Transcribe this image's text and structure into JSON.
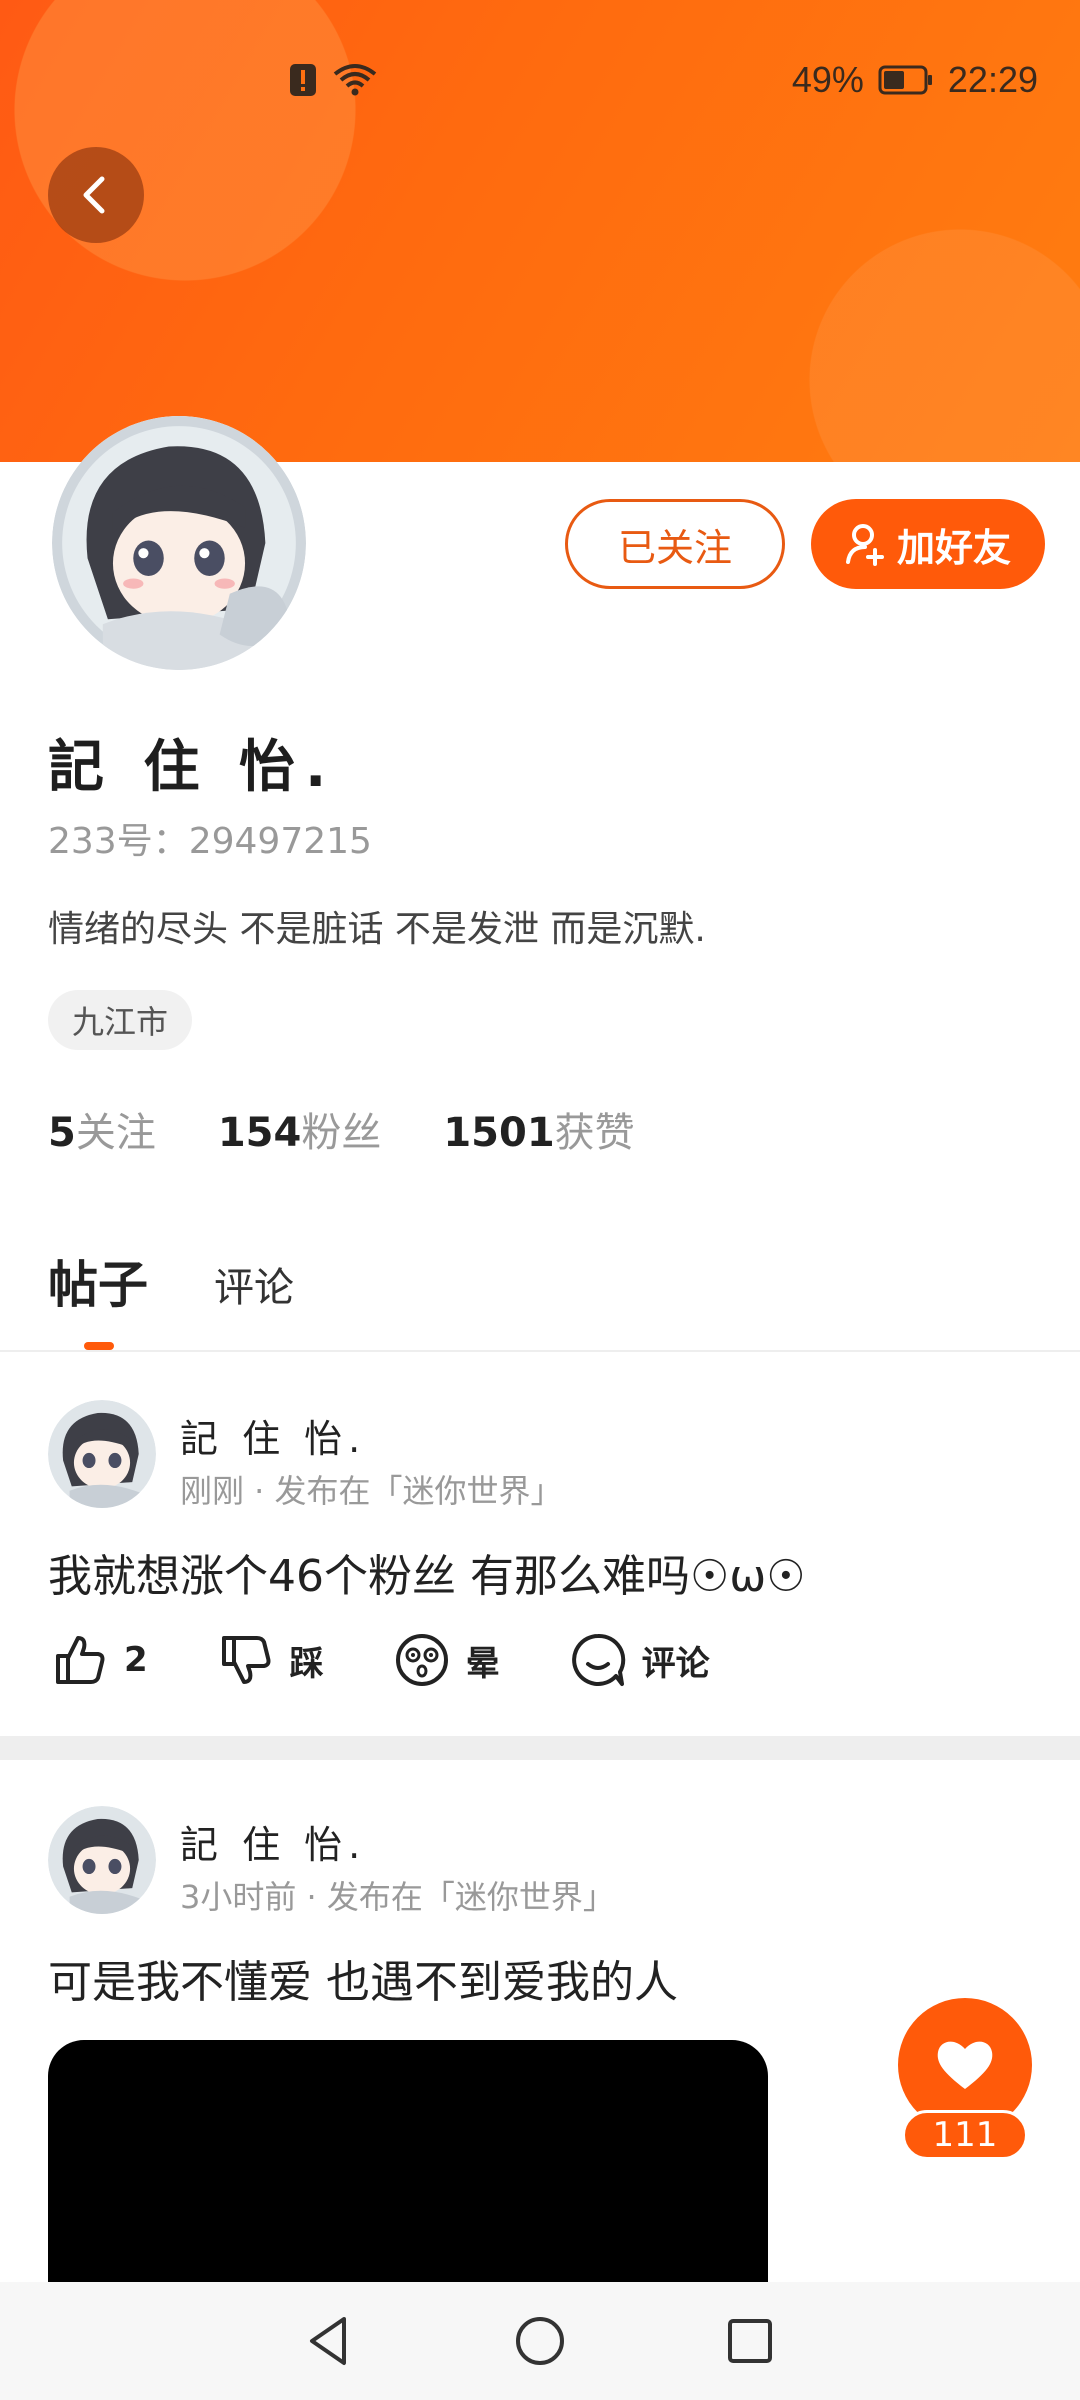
{
  "status_bar": {
    "battery": "49%",
    "time": "22:29"
  },
  "profile": {
    "name": "記 住 怡.",
    "uid": "233号：29497215",
    "bio": "情绪的尽头 不是脏话 不是发泄 而是沉默.",
    "location": "九江市",
    "follow_button": "已关注",
    "add_friend_button": "加好友",
    "stats": [
      {
        "num": "5",
        "label": "关注"
      },
      {
        "num": "154",
        "label": "粉丝"
      },
      {
        "num": "1501",
        "label": "获赞"
      }
    ]
  },
  "tabs": [
    {
      "label": "帖子",
      "active": true
    },
    {
      "label": "评论",
      "active": false
    }
  ],
  "posts": [
    {
      "author": "記 住 怡.",
      "meta": "刚刚 · 发布在「迷你世界」",
      "text": "我就想涨个46个粉丝 有那么难吗☉ω☉",
      "actions": [
        {
          "icon": "thumbs-up-icon",
          "label": "2"
        },
        {
          "icon": "thumbs-down-icon",
          "label": "踩"
        },
        {
          "icon": "dizzy-face-icon",
          "label": "晕"
        },
        {
          "icon": "comment-icon",
          "label": "评论"
        }
      ]
    },
    {
      "author": "記 住 怡.",
      "meta": "3小时前 · 发布在「迷你世界」",
      "text": "可是我不懂爱 也遇不到爱我的人"
    }
  ],
  "floating_like": {
    "icon": "heart-icon",
    "count": "111"
  },
  "colors": {
    "accent": "#ff5a0a",
    "banner": "#ff6a0f"
  }
}
